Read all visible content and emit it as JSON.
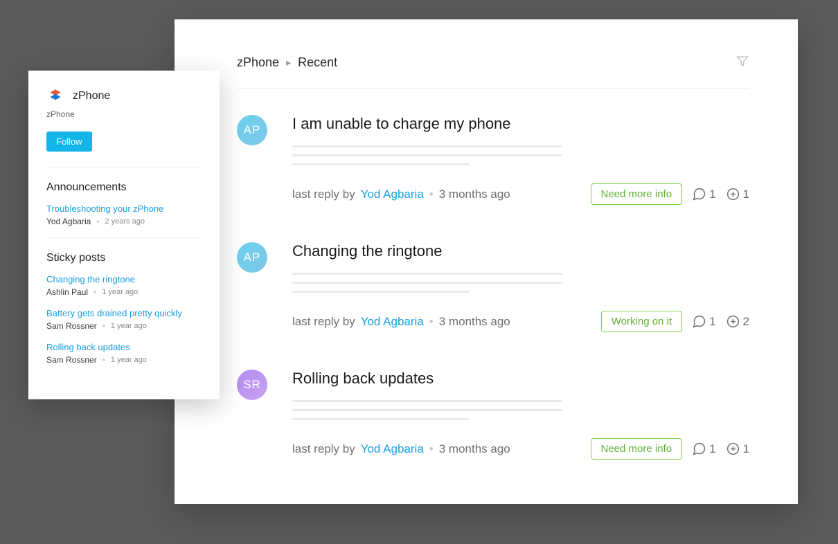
{
  "breadcrumb": {
    "root": "zPhone",
    "current": "Recent"
  },
  "threads": [
    {
      "initials": "AP",
      "avatar_class": "blue",
      "title": "I am unable to charge my phone",
      "reply_prefix": "last reply by",
      "reply_author": "Yod Agbaria",
      "reply_time": "3 months ago",
      "status": "Need more info",
      "comments": 1,
      "upvotes": 1
    },
    {
      "initials": "AP",
      "avatar_class": "blue",
      "title": "Changing the ringtone",
      "reply_prefix": "last reply by",
      "reply_author": "Yod Agbaria",
      "reply_time": "3 months ago",
      "status": "Working on it",
      "comments": 1,
      "upvotes": 2
    },
    {
      "initials": "SR",
      "avatar_class": "purple",
      "title": "Rolling back updates",
      "reply_prefix": "last reply by",
      "reply_author": "Yod Agbaria",
      "reply_time": "3 months ago",
      "status": "Need more info",
      "comments": 1,
      "upvotes": 1
    }
  ],
  "sidebar": {
    "product": "zPhone",
    "subtitle": "zPhone",
    "follow_label": "Follow",
    "announcements_title": "Announcements",
    "announcements": [
      {
        "title": "Troubleshooting your zPhone",
        "author": "Yod Agbaria",
        "time": "2 years ago"
      }
    ],
    "sticky_title": "Sticky posts",
    "sticky": [
      {
        "title": "Changing the ringtone",
        "author": "Ashlin Paul",
        "time": "1 year ago"
      },
      {
        "title": "Battery gets drained pretty quickly",
        "author": "Sam Rossner",
        "time": "1 year ago"
      },
      {
        "title": "Rolling back updates",
        "author": "Sam Rossner",
        "time": "1 year ago"
      }
    ]
  }
}
